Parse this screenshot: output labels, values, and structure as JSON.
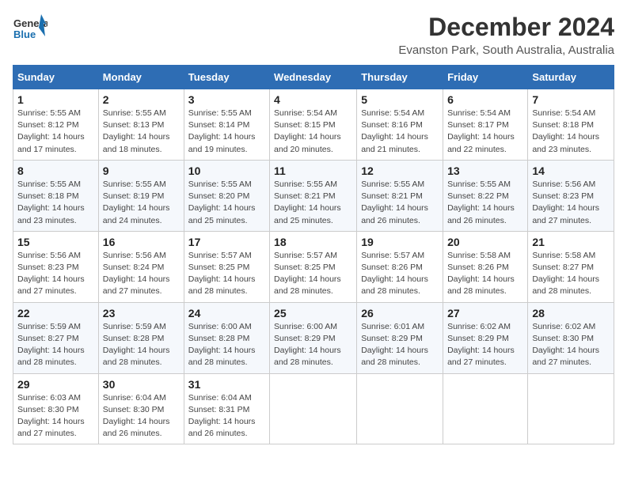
{
  "logo": {
    "line1": "General",
    "line2": "Blue"
  },
  "title": "December 2024",
  "location": "Evanston Park, South Australia, Australia",
  "days_of_week": [
    "Sunday",
    "Monday",
    "Tuesday",
    "Wednesday",
    "Thursday",
    "Friday",
    "Saturday"
  ],
  "weeks": [
    [
      {
        "day": "1",
        "sunrise": "5:55 AM",
        "sunset": "8:12 PM",
        "daylight": "14 hours and 17 minutes."
      },
      {
        "day": "2",
        "sunrise": "5:55 AM",
        "sunset": "8:13 PM",
        "daylight": "14 hours and 18 minutes."
      },
      {
        "day": "3",
        "sunrise": "5:55 AM",
        "sunset": "8:14 PM",
        "daylight": "14 hours and 19 minutes."
      },
      {
        "day": "4",
        "sunrise": "5:54 AM",
        "sunset": "8:15 PM",
        "daylight": "14 hours and 20 minutes."
      },
      {
        "day": "5",
        "sunrise": "5:54 AM",
        "sunset": "8:16 PM",
        "daylight": "14 hours and 21 minutes."
      },
      {
        "day": "6",
        "sunrise": "5:54 AM",
        "sunset": "8:17 PM",
        "daylight": "14 hours and 22 minutes."
      },
      {
        "day": "7",
        "sunrise": "5:54 AM",
        "sunset": "8:18 PM",
        "daylight": "14 hours and 23 minutes."
      }
    ],
    [
      {
        "day": "8",
        "sunrise": "5:55 AM",
        "sunset": "8:18 PM",
        "daylight": "14 hours and 23 minutes."
      },
      {
        "day": "9",
        "sunrise": "5:55 AM",
        "sunset": "8:19 PM",
        "daylight": "14 hours and 24 minutes."
      },
      {
        "day": "10",
        "sunrise": "5:55 AM",
        "sunset": "8:20 PM",
        "daylight": "14 hours and 25 minutes."
      },
      {
        "day": "11",
        "sunrise": "5:55 AM",
        "sunset": "8:21 PM",
        "daylight": "14 hours and 25 minutes."
      },
      {
        "day": "12",
        "sunrise": "5:55 AM",
        "sunset": "8:21 PM",
        "daylight": "14 hours and 26 minutes."
      },
      {
        "day": "13",
        "sunrise": "5:55 AM",
        "sunset": "8:22 PM",
        "daylight": "14 hours and 26 minutes."
      },
      {
        "day": "14",
        "sunrise": "5:56 AM",
        "sunset": "8:23 PM",
        "daylight": "14 hours and 27 minutes."
      }
    ],
    [
      {
        "day": "15",
        "sunrise": "5:56 AM",
        "sunset": "8:23 PM",
        "daylight": "14 hours and 27 minutes."
      },
      {
        "day": "16",
        "sunrise": "5:56 AM",
        "sunset": "8:24 PM",
        "daylight": "14 hours and 27 minutes."
      },
      {
        "day": "17",
        "sunrise": "5:57 AM",
        "sunset": "8:25 PM",
        "daylight": "14 hours and 28 minutes."
      },
      {
        "day": "18",
        "sunrise": "5:57 AM",
        "sunset": "8:25 PM",
        "daylight": "14 hours and 28 minutes."
      },
      {
        "day": "19",
        "sunrise": "5:57 AM",
        "sunset": "8:26 PM",
        "daylight": "14 hours and 28 minutes."
      },
      {
        "day": "20",
        "sunrise": "5:58 AM",
        "sunset": "8:26 PM",
        "daylight": "14 hours and 28 minutes."
      },
      {
        "day": "21",
        "sunrise": "5:58 AM",
        "sunset": "8:27 PM",
        "daylight": "14 hours and 28 minutes."
      }
    ],
    [
      {
        "day": "22",
        "sunrise": "5:59 AM",
        "sunset": "8:27 PM",
        "daylight": "14 hours and 28 minutes."
      },
      {
        "day": "23",
        "sunrise": "5:59 AM",
        "sunset": "8:28 PM",
        "daylight": "14 hours and 28 minutes."
      },
      {
        "day": "24",
        "sunrise": "6:00 AM",
        "sunset": "8:28 PM",
        "daylight": "14 hours and 28 minutes."
      },
      {
        "day": "25",
        "sunrise": "6:00 AM",
        "sunset": "8:29 PM",
        "daylight": "14 hours and 28 minutes."
      },
      {
        "day": "26",
        "sunrise": "6:01 AM",
        "sunset": "8:29 PM",
        "daylight": "14 hours and 28 minutes."
      },
      {
        "day": "27",
        "sunrise": "6:02 AM",
        "sunset": "8:29 PM",
        "daylight": "14 hours and 27 minutes."
      },
      {
        "day": "28",
        "sunrise": "6:02 AM",
        "sunset": "8:30 PM",
        "daylight": "14 hours and 27 minutes."
      }
    ],
    [
      {
        "day": "29",
        "sunrise": "6:03 AM",
        "sunset": "8:30 PM",
        "daylight": "14 hours and 27 minutes."
      },
      {
        "day": "30",
        "sunrise": "6:04 AM",
        "sunset": "8:30 PM",
        "daylight": "14 hours and 26 minutes."
      },
      {
        "day": "31",
        "sunrise": "6:04 AM",
        "sunset": "8:31 PM",
        "daylight": "14 hours and 26 minutes."
      },
      null,
      null,
      null,
      null
    ]
  ]
}
